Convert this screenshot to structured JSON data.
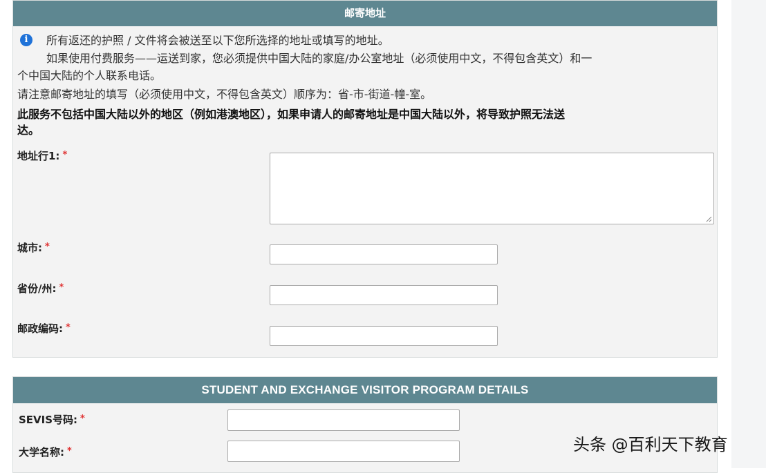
{
  "mailing": {
    "header": "邮寄地址",
    "info_icon": "info-icon",
    "info_lines": [
      "所有返还的护照 / 文件将会被送至以下您所选择的地址或填写的地址。",
      "如果使用付费服务——运送到家，您必须提供中国大陆的家庭/办公室地址（必须使用中文，不得包含英文）和一",
      "个中国大陆的个人联系电话。",
      "请注意邮寄地址的填写（必须使用中文，不得包含英文）顺序为：省-市-街道-幢-室。",
      "此服务不包括中国大陆以外的地区（例如港澳地区），如果申请人的邮寄地址是中国大陆以外，将导致护照无法送",
      "达。"
    ],
    "fields": {
      "address_line1": {
        "label": "地址行1:",
        "value": ""
      },
      "city": {
        "label": "城市:",
        "value": ""
      },
      "province": {
        "label": "省份/州:",
        "value": ""
      },
      "postal_code": {
        "label": "邮政编码:",
        "value": ""
      }
    },
    "required_mark": "*"
  },
  "sevp": {
    "header": "STUDENT AND EXCHANGE VISITOR PROGRAM DETAILS",
    "fields": {
      "sevis_number": {
        "label": "SEVIS号码:",
        "value": ""
      },
      "university_name": {
        "label": "大学名称:",
        "value": ""
      }
    },
    "required_mark": "*"
  },
  "watermark": "头条 @百利天下教育",
  "colors": {
    "header_bg": "#5e8791",
    "panel_bg": "#f3f3f3",
    "required": "#e03535",
    "info_icon": "#1f72d8"
  }
}
